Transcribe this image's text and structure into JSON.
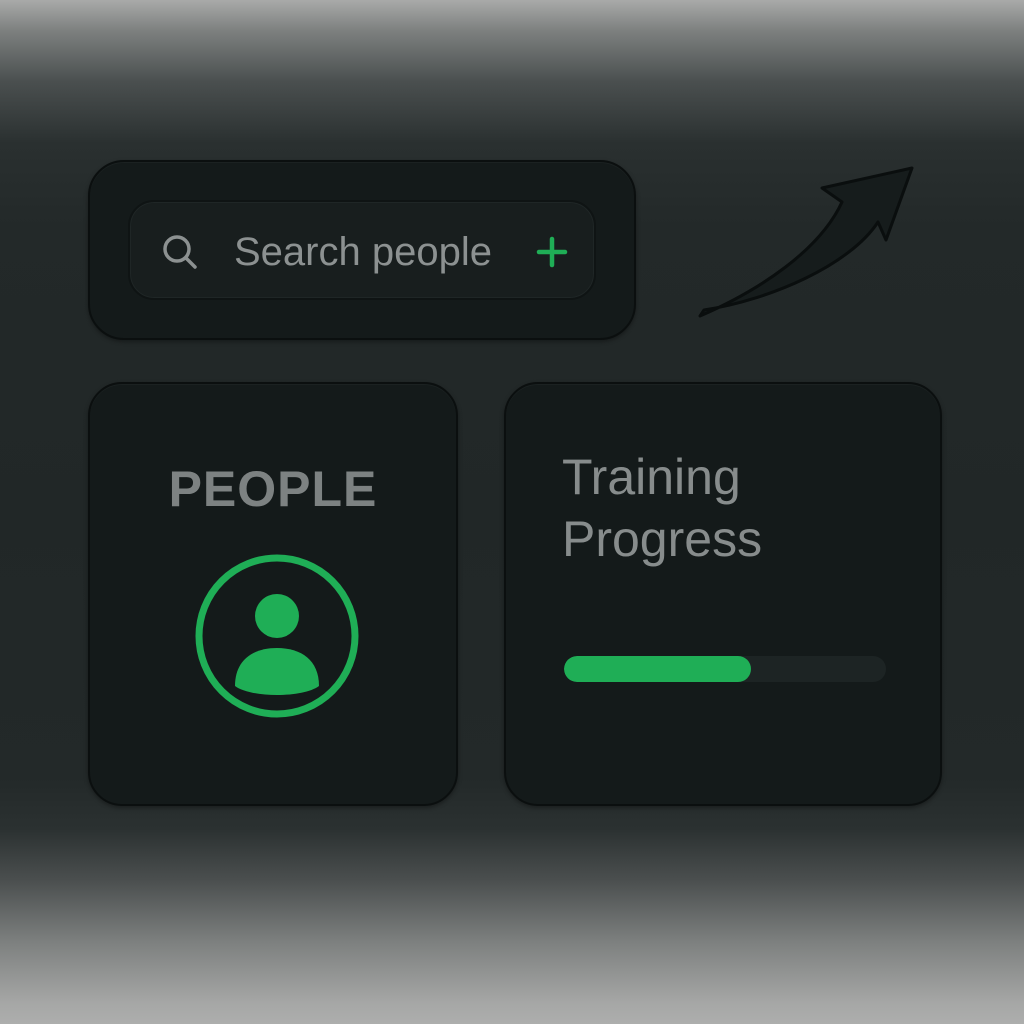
{
  "search": {
    "placeholder": "Search people",
    "icon": "search-icon",
    "add_icon": "plus-icon"
  },
  "trend": {
    "icon": "trend-up-arrow-icon"
  },
  "people_card": {
    "title": "PEOPLE",
    "icon": "user-avatar-icon"
  },
  "training_card": {
    "title_line1": "Training",
    "title_line2": "Progress",
    "progress": 0.58
  },
  "colors": {
    "accent": "#1fae56",
    "card": "#141a1a",
    "text_muted": "#878c8c"
  }
}
